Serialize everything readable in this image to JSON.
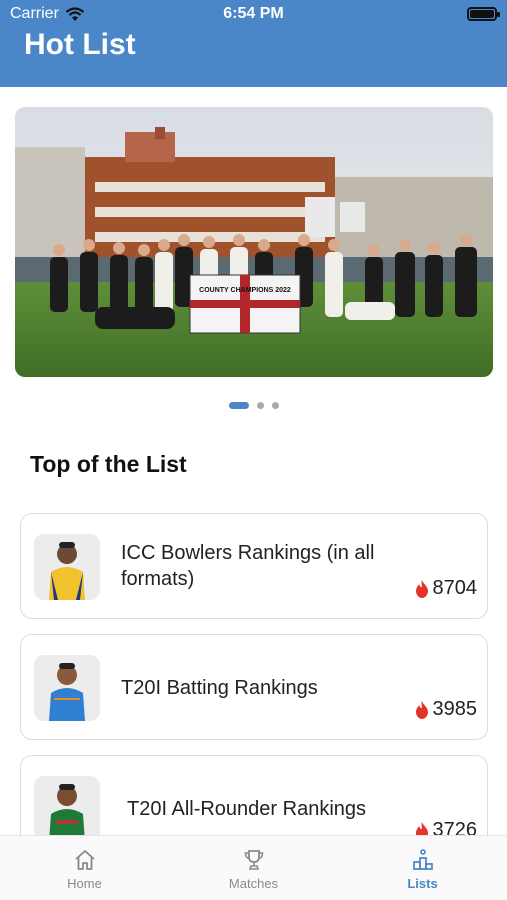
{
  "status_bar": {
    "carrier": "Carrier",
    "time": "6:54 PM"
  },
  "header": {
    "title": "Hot List"
  },
  "carousel": {
    "banner_text": "COUNTY CHAMPIONS 2022",
    "page_count": 3,
    "active_index": 0
  },
  "section": {
    "title": "Top of the List"
  },
  "list": [
    {
      "name": "ICC Bowlers Rankings (in all formats)",
      "score": "8704",
      "jersey_color": "#f2c12e"
    },
    {
      "name": "T20I Batting Rankings",
      "score": "3985",
      "jersey_color": "#2f7fd3"
    },
    {
      "name": "T20I All-Rounder Rankings",
      "score": "3726",
      "jersey_color": "#1f7a3a"
    }
  ],
  "tabs": [
    {
      "label": "Home",
      "icon": "home-icon",
      "active": false
    },
    {
      "label": "Matches",
      "icon": "trophy-icon",
      "active": false
    },
    {
      "label": "Lists",
      "icon": "podium-icon",
      "active": true
    }
  ],
  "colors": {
    "accent": "#4a86c8",
    "flame": "#e5332a"
  }
}
